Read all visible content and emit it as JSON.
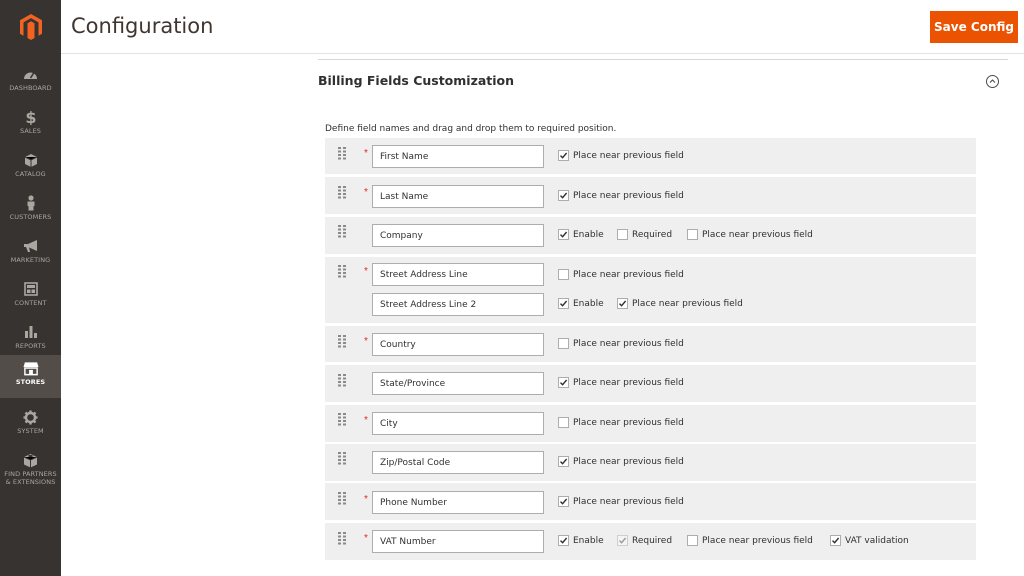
{
  "header": {
    "title": "Configuration",
    "save_label": "Save Config"
  },
  "sidebar": {
    "items": [
      {
        "label": "Dashboard",
        "icon": "dashboard-icon",
        "active": false
      },
      {
        "label": "Sales",
        "icon": "dollar-icon",
        "active": false
      },
      {
        "label": "Catalog",
        "icon": "box-icon",
        "active": false
      },
      {
        "label": "Customers",
        "icon": "person-icon",
        "active": false
      },
      {
        "label": "Marketing",
        "icon": "megaphone-icon",
        "active": false
      },
      {
        "label": "Content",
        "icon": "content-layout-icon",
        "active": false
      },
      {
        "label": "Reports",
        "icon": "bar-chart-icon",
        "active": false
      },
      {
        "label": "Stores",
        "icon": "store-icon",
        "active": true
      },
      {
        "label": "System",
        "icon": "gear-icon",
        "active": false
      },
      {
        "label": "Find Partners & Extensions",
        "icon": "extensions-box-icon",
        "active": false
      }
    ]
  },
  "section": {
    "title": "Billing Fields Customization",
    "hint": "Define field names and drag and drop them to required position."
  },
  "option_labels": {
    "place_near": "Place near previous field",
    "enable": "Enable",
    "required": "Required",
    "vat_validation": "VAT validation"
  },
  "rows": [
    {
      "field": "First Name",
      "required": true,
      "enable": null,
      "required_opt": null,
      "place_near": true
    },
    {
      "field": "Last Name",
      "required": true,
      "enable": null,
      "required_opt": null,
      "place_near": true
    },
    {
      "field": "Company",
      "required": false,
      "enable": true,
      "required_opt": false,
      "place_near": false
    },
    {
      "field": "Street Address Line",
      "required": true,
      "enable": null,
      "required_opt": null,
      "place_near": false
    },
    {
      "field": "Street Address Line 2",
      "required": false,
      "enable": true,
      "required_opt": null,
      "place_near": true
    },
    {
      "field": "Country",
      "required": true,
      "enable": null,
      "required_opt": null,
      "place_near": false
    },
    {
      "field": "State/Province",
      "required": false,
      "enable": null,
      "required_opt": null,
      "place_near": true
    },
    {
      "field": "City",
      "required": true,
      "enable": null,
      "required_opt": null,
      "place_near": false
    },
    {
      "field": "Zip/Postal Code",
      "required": false,
      "enable": null,
      "required_opt": null,
      "place_near": true
    },
    {
      "field": "Phone Number",
      "required": true,
      "enable": null,
      "required_opt": null,
      "place_near": true
    },
    {
      "field": "VAT Number",
      "required": true,
      "enable": true,
      "required_opt": true,
      "required_opt_disabled": true,
      "place_near": false,
      "vat_validation": true
    }
  ],
  "colors": {
    "accent": "#eb5202",
    "sidebar_bg": "#373330",
    "sidebar_active": "#524d49",
    "required_star": "#e22626"
  }
}
